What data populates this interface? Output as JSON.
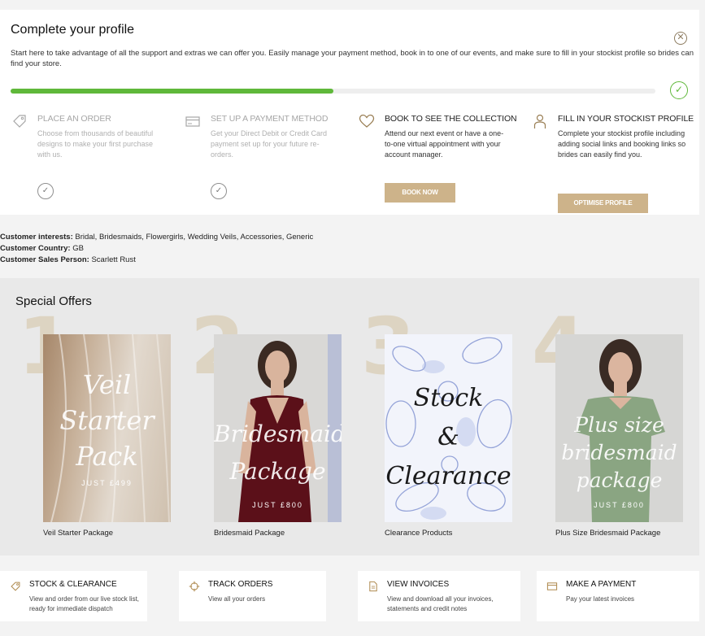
{
  "profile": {
    "title": "Complete your profile",
    "close_icon": "close-icon",
    "intro": "Start here to take advantage of all the support and extras we can offer you. Easily manage your payment method, book in to one of our events, and make sure to fill in your stockist profile so brides can find your store.",
    "progress_fraction": 0.5,
    "progress_color": "#5fb83a",
    "steps": [
      {
        "icon": "tag-icon",
        "title": "PLACE AN ORDER",
        "description": "Choose from thousands of beautiful designs to make your first purchase with us.",
        "status": "done"
      },
      {
        "icon": "credit-card-icon",
        "title": "SET UP A PAYMENT METHOD",
        "description": "Get your Direct Debit or Credit Card payment set up for your future re-orders.",
        "status": "done"
      },
      {
        "icon": "heart-icon",
        "title": "BOOK TO SEE THE COLLECTION",
        "description": "Attend our next event or have a one-to-one virtual appointment with your account manager.",
        "status": "todo",
        "button": "BOOK NOW"
      },
      {
        "icon": "user-icon",
        "title": "FILL IN YOUR STOCKIST PROFILE",
        "description": "Complete your stockist profile including adding social links and booking links so brides can easily find you.",
        "status": "todo",
        "button": "OPTIMISE PROFILE"
      }
    ]
  },
  "customer": {
    "interests_label": "Customer interests:",
    "interests": "Bridal, Bridesmaids, Flowergirls, Wedding Veils, Accessories, Generic",
    "country_label": "Customer Country:",
    "country": "GB",
    "sales_label": "Customer Sales Person:",
    "sales_person": "Scarlett Rust"
  },
  "offers": {
    "title": "Special Offers",
    "items": [
      {
        "number": "1",
        "image_lines": [
          "Veil",
          "Starter",
          "Pack"
        ],
        "price": "JUST £499",
        "caption": "Veil Starter Package"
      },
      {
        "number": "2",
        "image_lines": [
          "Bridesmaid",
          "Package"
        ],
        "price": "JUST £800",
        "caption": "Bridesmaid Package"
      },
      {
        "number": "3",
        "image_lines": [
          "Stock",
          "&",
          "Clearance"
        ],
        "price": "",
        "caption": "Clearance Products"
      },
      {
        "number": "4",
        "image_lines": [
          "Plus size",
          "bridesmaid",
          "package"
        ],
        "price": "JUST £800",
        "caption": "Plus Size Bridesmaid Package"
      }
    ]
  },
  "quick_links": [
    {
      "icon": "tag-icon",
      "title": "STOCK & CLEARANCE",
      "description": "View and order from our live stock list, ready for immediate dispatch"
    },
    {
      "icon": "crosshair-icon",
      "title": "TRACK ORDERS",
      "description": "View all your orders"
    },
    {
      "icon": "document-icon",
      "title": "VIEW INVOICES",
      "description": "View and download all your invoices, statements and credit notes"
    },
    {
      "icon": "credit-card-icon",
      "title": "MAKE A PAYMENT",
      "description": "Pay your latest invoices"
    }
  ],
  "colors": {
    "accent": "#cdb38a",
    "success": "#5fb83a",
    "offer_number": "#ddd4c2"
  }
}
